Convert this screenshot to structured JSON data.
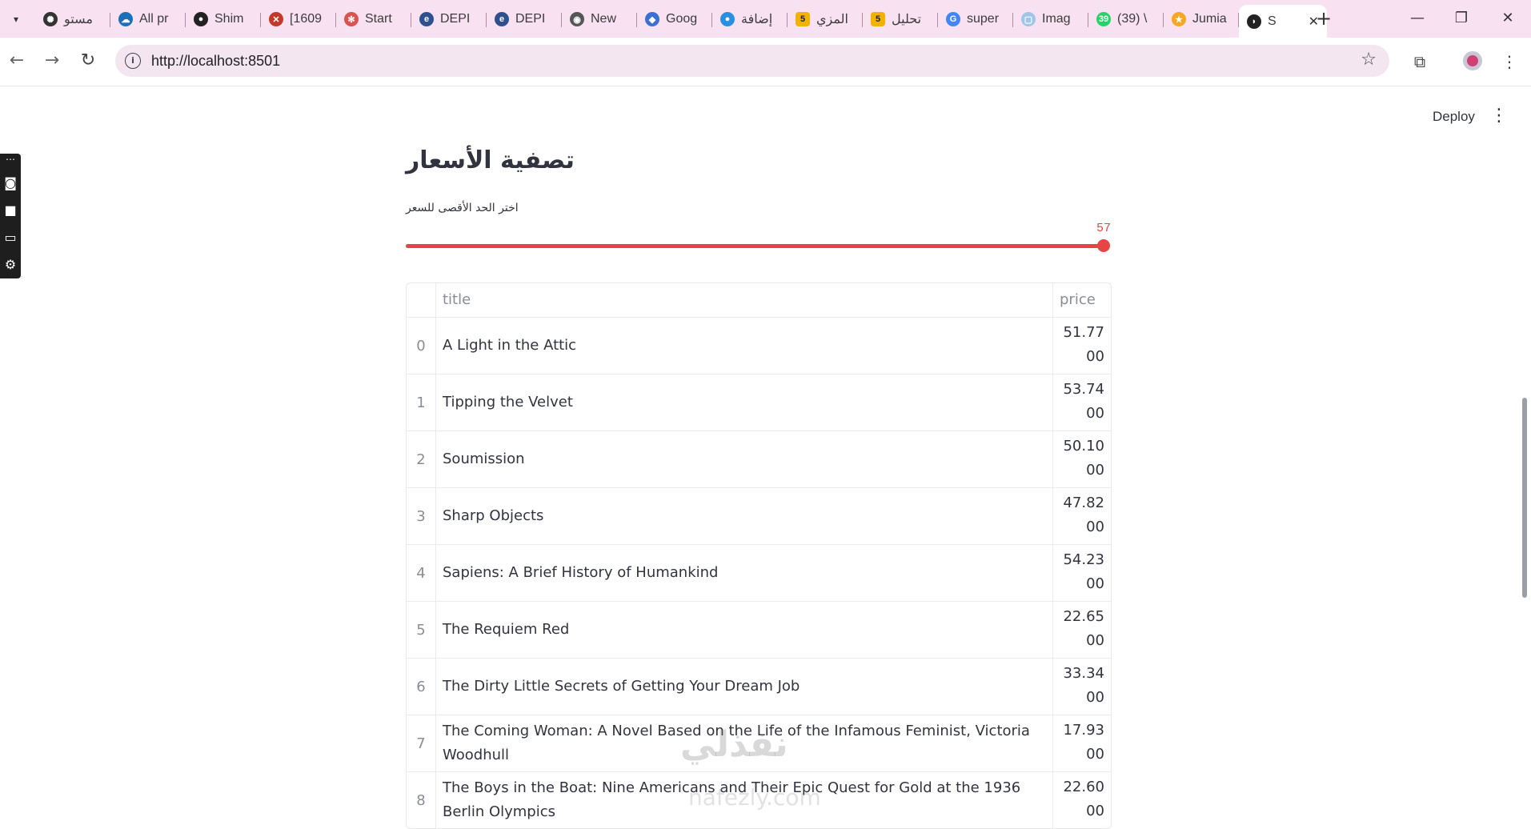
{
  "browser": {
    "tabs": [
      {
        "label": "مستو",
        "icon": "openai-icon"
      },
      {
        "label": "All pr",
        "icon": "salesforce-icon"
      },
      {
        "label": "Shim",
        "icon": "github-icon"
      },
      {
        "label": "[1609",
        "icon": "x-icon"
      },
      {
        "label": "Start",
        "icon": "figma-icon"
      },
      {
        "label": "DEPI",
        "icon": "depi-icon"
      },
      {
        "label": "DEPI",
        "icon": "depi-icon"
      },
      {
        "label": "New",
        "icon": "chrome-icon"
      },
      {
        "label": "Goog",
        "icon": "gemini-icon"
      },
      {
        "label": "إضافة",
        "icon": "circle-icon"
      },
      {
        "label": "المزي",
        "icon": "five-badge-icon"
      },
      {
        "label": "تحليل",
        "icon": "five-badge-icon"
      },
      {
        "label": "super",
        "icon": "google-icon"
      },
      {
        "label": "Imag",
        "icon": "image-icon"
      },
      {
        "label": "(39) \\",
        "icon": "whatsapp-icon"
      },
      {
        "label": "Jumia",
        "icon": "star-icon"
      },
      {
        "label": "S",
        "icon": "streamlit-icon",
        "active": true
      }
    ],
    "five_badge": "5",
    "whatsapp_badge": "39",
    "url": "http://localhost:8501"
  },
  "app": {
    "deploy_label": "Deploy",
    "title": "تصفية الأسعار",
    "slider_label": "اختر الحد الأقصى للسعر",
    "slider_value": "57",
    "slider_fraction": 1.0,
    "accent_color": "#e64545"
  },
  "table": {
    "columns": [
      "title",
      "price"
    ],
    "rows": [
      {
        "index": "0",
        "title": "A Light in the Attic",
        "price": "51.7700"
      },
      {
        "index": "1",
        "title": "Tipping the Velvet",
        "price": "53.7400"
      },
      {
        "index": "2",
        "title": "Soumission",
        "price": "50.1000"
      },
      {
        "index": "3",
        "title": "Sharp Objects",
        "price": "47.8200"
      },
      {
        "index": "4",
        "title": "Sapiens: A Brief History of Humankind",
        "price": "54.2300"
      },
      {
        "index": "5",
        "title": "The Requiem Red",
        "price": "22.6500"
      },
      {
        "index": "6",
        "title": "The Dirty Little Secrets of Getting Your Dream Job",
        "price": "33.3400"
      },
      {
        "index": "7",
        "title": "The Coming Woman: A Novel Based on the Life of the Infamous Feminist, Victoria Woodhull",
        "price": "17.9300"
      },
      {
        "index": "8",
        "title": "The Boys in the Boat: Nine Americans and Their Epic Quest for Gold at the 1936 Berlin Olympics",
        "price": "22.6000"
      }
    ]
  },
  "watermark": {
    "text": "نفذلي",
    "sub": "nafezly.com"
  }
}
